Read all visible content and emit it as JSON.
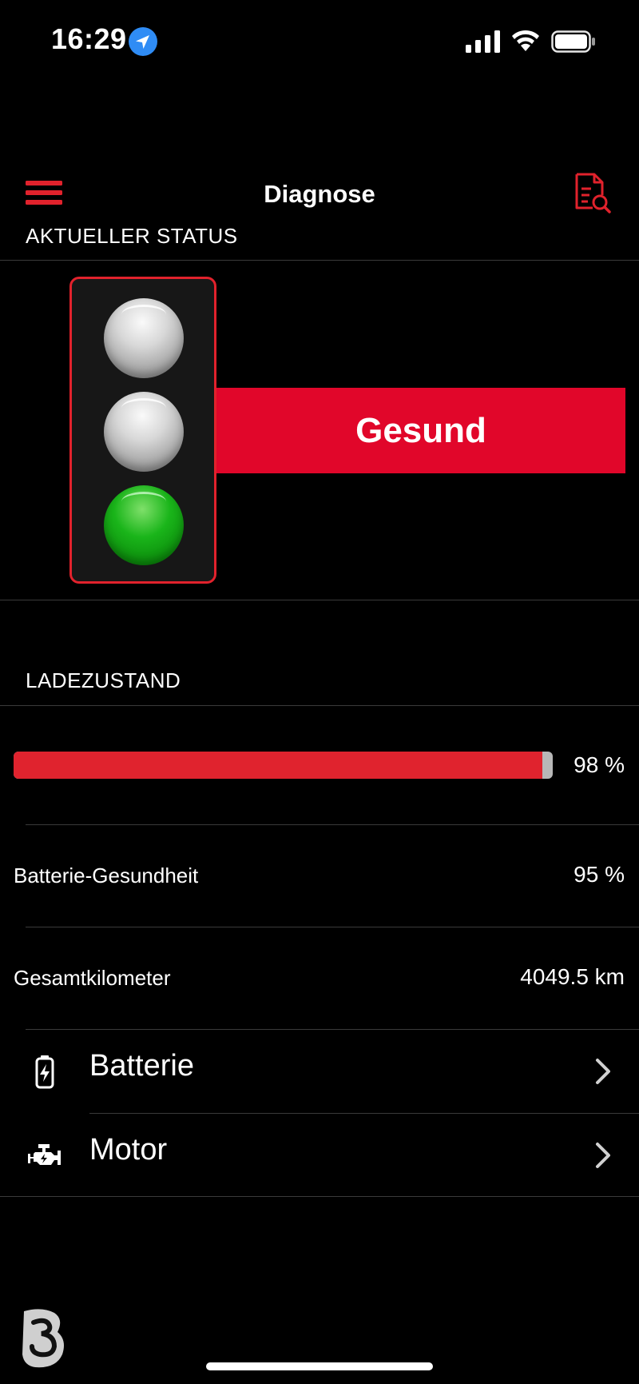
{
  "status_bar": {
    "time": "16:29"
  },
  "nav": {
    "title": "Diagnose"
  },
  "current_status": {
    "header": "AKTUELLER STATUS",
    "state": "Gesund",
    "active_light": "green"
  },
  "charge": {
    "header": "LADEZUSTAND",
    "percent": 98,
    "label": "98 %"
  },
  "stats": [
    {
      "label": "Batterie-Gesundheit",
      "value": "95 %"
    },
    {
      "label": "Gesamtkilometer",
      "value": "4049.5 km"
    }
  ],
  "nav_items": [
    {
      "label": "Batterie",
      "icon": "battery-charging-icon"
    },
    {
      "label": "Motor",
      "icon": "engine-icon"
    }
  ],
  "colors": {
    "accent": "#e1062a",
    "background": "#000000",
    "divider": "#3a3a3a"
  }
}
